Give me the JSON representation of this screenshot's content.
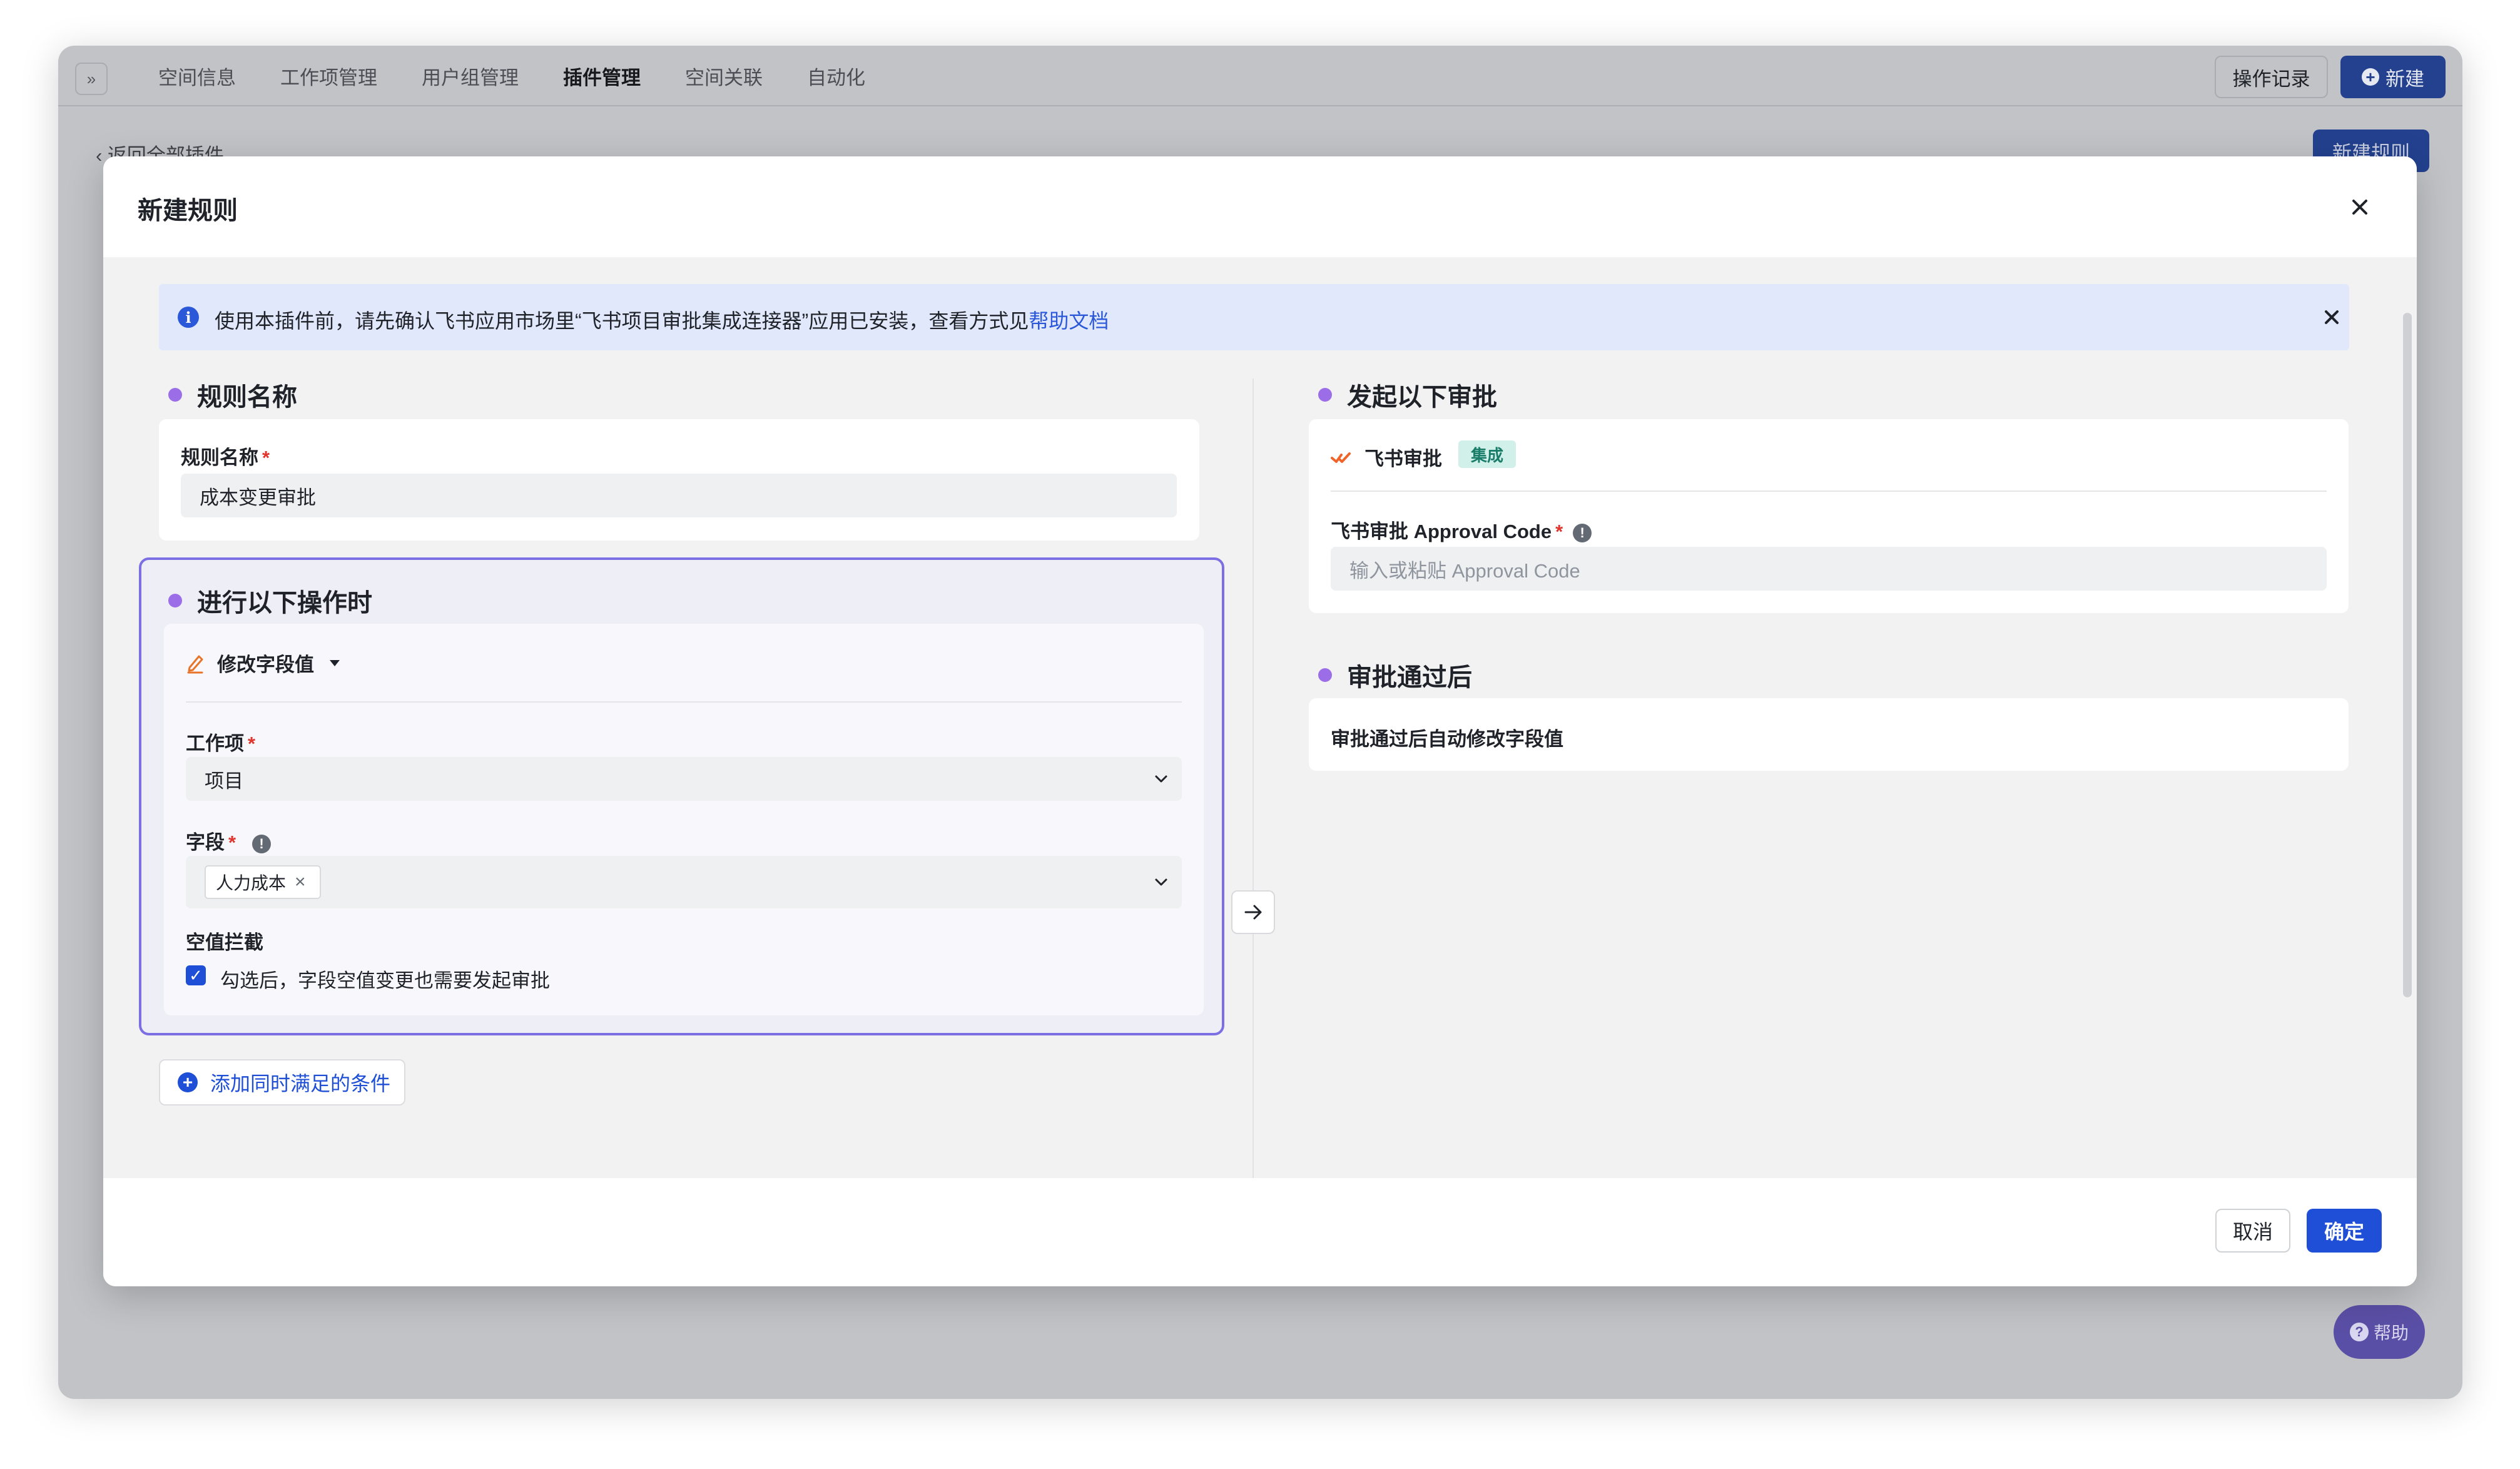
{
  "nav": {
    "expand_icon": "»",
    "tabs": [
      "空间信息",
      "工作项管理",
      "用户组管理",
      "插件管理",
      "空间关联",
      "自动化"
    ],
    "history_label": "操作记录",
    "create_label": "新建"
  },
  "page": {
    "back_label": "返回全部插件",
    "new_rule_label": "新建规则",
    "help_label": "帮助"
  },
  "modal": {
    "title": "新建规则",
    "alert_text": "使用本插件前，请先确认飞书应用市场里“飞书项目审批集成连接器”应用已安装，查看方式见",
    "alert_link": "帮助文档",
    "rule_section": {
      "title": "规则名称",
      "field_label": "规则名称",
      "required_mark": "*",
      "value": "成本变更审批"
    },
    "trigger_section": {
      "title": "进行以下操作时",
      "action_label": "修改字段值",
      "work_item_label": "工作项",
      "work_item_value": "项目",
      "field_label": "字段",
      "field_tag": "人力成本",
      "empty_label": "空值拦截",
      "empty_checkbox_text": "勾选后，字段空值变更也需要发起审批"
    },
    "add_condition_label": "添加同时满足的条件",
    "approval_section": {
      "title": "发起以下审批",
      "app_name": "飞书审批",
      "badge": "集成",
      "code_label": "飞书审批 Approval Code",
      "code_placeholder": "输入或粘贴 Approval Code"
    },
    "after_section": {
      "title": "审批通过后",
      "text": "审批通过后自动修改字段值"
    },
    "cancel_label": "取消",
    "ok_label": "确定"
  },
  "colors": {
    "primary": "#1e4fd6",
    "accent_purple": "#9b6ee8",
    "trigger_border": "#7b6fe3",
    "required": "#e0342c",
    "badge_bg": "#d2f0ea",
    "badge_text": "#1a7d69"
  }
}
